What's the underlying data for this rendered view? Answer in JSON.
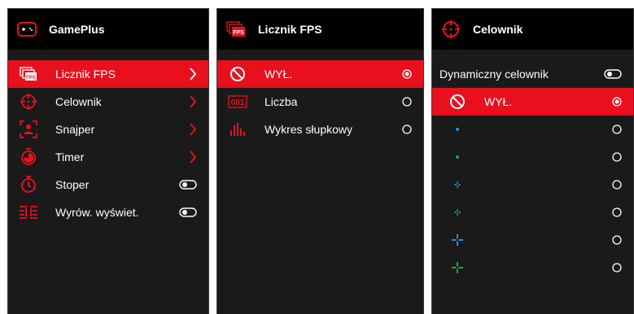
{
  "colors": {
    "accent": "#e8101e",
    "panel": "#1a1a1a",
    "header": "#000000",
    "dot_blue": "#2a8fd6",
    "dot_green": "#1fa84a"
  },
  "gameplus": {
    "title": "GamePlus",
    "items": [
      {
        "label": "Licznik FPS",
        "icon": "fps-icon",
        "control": "chevron"
      },
      {
        "label": "Celownik",
        "icon": "crosshair-icon",
        "control": "chevron"
      },
      {
        "label": "Snajper",
        "icon": "sniper-icon",
        "control": "chevron"
      },
      {
        "label": "Timer",
        "icon": "timer-icon",
        "control": "chevron"
      },
      {
        "label": "Stoper",
        "icon": "stopwatch-icon",
        "control": "toggle"
      },
      {
        "label": "Wyrów. wyświet.",
        "icon": "display-align-icon",
        "control": "toggle"
      }
    ]
  },
  "fps": {
    "title": "Licznik FPS",
    "items": [
      {
        "label": "WYŁ.",
        "icon": "off-icon",
        "selected": true
      },
      {
        "label": "Liczba",
        "icon": "number-icon",
        "icon_text": "001",
        "selected": false
      },
      {
        "label": "Wykres słupkowy",
        "icon": "bar-graph-icon",
        "selected": false
      }
    ]
  },
  "crosshair": {
    "title": "Celownik",
    "dynamic_label": "Dynamiczny celownik",
    "items": [
      {
        "label": "WYŁ.",
        "icon": "off-icon",
        "selected": true
      },
      {
        "label": "",
        "icon": "blue-dot-icon",
        "selected": false
      },
      {
        "label": "",
        "icon": "green-dot-icon",
        "selected": false
      },
      {
        "label": "",
        "icon": "blue-small-cross-icon",
        "selected": false
      },
      {
        "label": "",
        "icon": "green-small-cross-icon",
        "selected": false
      },
      {
        "label": "",
        "icon": "blue-cross-icon",
        "selected": false
      },
      {
        "label": "",
        "icon": "green-cross-icon",
        "selected": false
      }
    ]
  }
}
